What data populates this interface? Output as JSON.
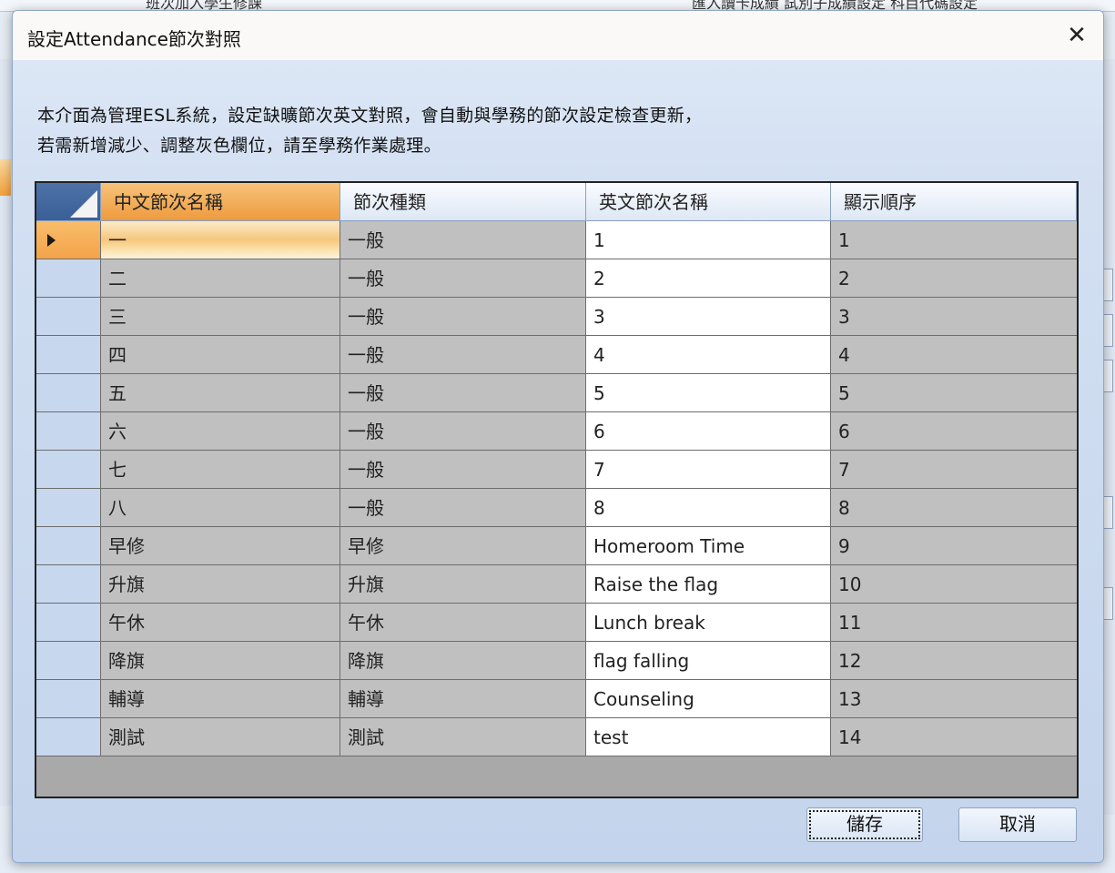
{
  "background": {
    "top_left_text": "班次加入學生修課",
    "top_right_text": "匯入讀卡成績   試別子成績設定   科目代碼設定"
  },
  "dialog": {
    "title": "設定Attendance節次對照",
    "close_icon": "close-icon",
    "description": [
      "本介面為管理ESL系統，設定缺曠節次英文對照，會自動與學務的節次設定檢查更新，",
      "若需新增減少、調整灰色欄位，請至學務作業處理。"
    ],
    "grid": {
      "columns": [
        "中文節次名稱",
        "節次種類",
        "英文節次名稱",
        "顯示順序"
      ],
      "rows": [
        {
          "zh": "一",
          "type": "一般",
          "en": "1",
          "order": "1"
        },
        {
          "zh": "二",
          "type": "一般",
          "en": "2",
          "order": "2"
        },
        {
          "zh": "三",
          "type": "一般",
          "en": "3",
          "order": "3"
        },
        {
          "zh": "四",
          "type": "一般",
          "en": "4",
          "order": "4"
        },
        {
          "zh": "五",
          "type": "一般",
          "en": "5",
          "order": "5"
        },
        {
          "zh": "六",
          "type": "一般",
          "en": "6",
          "order": "6"
        },
        {
          "zh": "七",
          "type": "一般",
          "en": "7",
          "order": "7"
        },
        {
          "zh": "八",
          "type": "一般",
          "en": "8",
          "order": "8"
        },
        {
          "zh": "早修",
          "type": "早修",
          "en": "Homeroom Time",
          "order": "9"
        },
        {
          "zh": "升旗",
          "type": "升旗",
          "en": "Raise the flag",
          "order": "10"
        },
        {
          "zh": "午休",
          "type": "午休",
          "en": "Lunch break",
          "order": "11"
        },
        {
          "zh": "降旗",
          "type": "降旗",
          "en": "flag falling",
          "order": "12"
        },
        {
          "zh": "輔導",
          "type": "輔導",
          "en": "Counseling",
          "order": "13"
        },
        {
          "zh": "測試",
          "type": "測試",
          "en": "test",
          "order": "14"
        }
      ]
    },
    "buttons": {
      "save": "儲存",
      "cancel": "取消"
    }
  },
  "colors": {
    "header_active": "#ee9b3e",
    "readonly_cell": "#c0c0c0",
    "editable_cell": "#ffffff",
    "row_header": "#c7d8ee"
  }
}
